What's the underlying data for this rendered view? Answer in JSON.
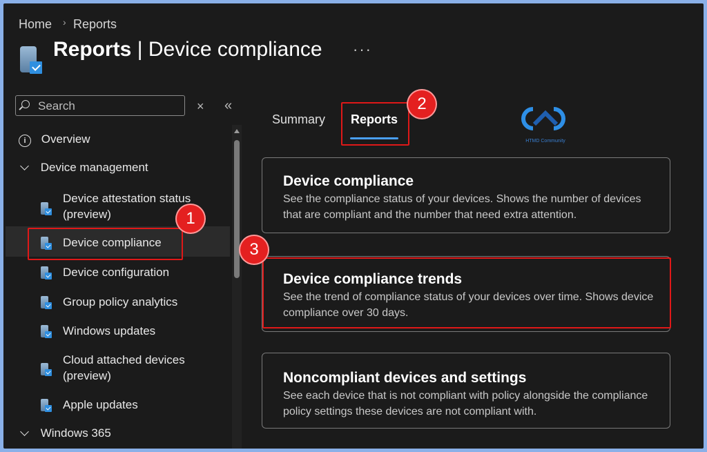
{
  "breadcrumb": {
    "home": "Home",
    "sep": "›",
    "current": "Reports"
  },
  "header": {
    "title_bold": "Reports",
    "title_sep": " | ",
    "title_rest": "Device compliance",
    "more": "···",
    "icon": "device-compliance-icon"
  },
  "sidebar": {
    "search_placeholder": "Search",
    "clear": "×",
    "collapse": "«",
    "overview": "Overview",
    "device_management": "Device management",
    "items": [
      {
        "label": "Device attestation status",
        "label2": "(preview)"
      },
      {
        "label": "Device compliance"
      },
      {
        "label": "Device configuration"
      },
      {
        "label": "Group policy analytics"
      },
      {
        "label": "Windows updates"
      },
      {
        "label": "Cloud attached devices",
        "label2": "(preview)"
      },
      {
        "label": "Apple updates"
      }
    ],
    "windows365": "Windows 365",
    "selected_index": 1
  },
  "tabs": [
    {
      "label": "Summary"
    },
    {
      "label": "Reports",
      "active": true
    }
  ],
  "logo": {
    "text": "HTMD Community"
  },
  "cards": [
    {
      "title": "Device compliance",
      "desc": "See the compliance status of your devices. Shows the number of devices that are compliant and the number that need extra attention."
    },
    {
      "title": "Device compliance trends",
      "desc": "See the trend of compliance status of your devices over time. Shows device compliance over 30 days."
    },
    {
      "title": "Noncompliant devices and settings",
      "desc": "See each device that is not compliant with policy alongside the compliance policy settings these devices are not compliant with."
    }
  ],
  "annotations": [
    {
      "number": "1"
    },
    {
      "number": "2"
    },
    {
      "number": "3"
    }
  ],
  "colors": {
    "background": "#1b1b1b",
    "frame": "#8ab0e8",
    "accent": "#4a9ff5",
    "highlight": "#e01818"
  }
}
